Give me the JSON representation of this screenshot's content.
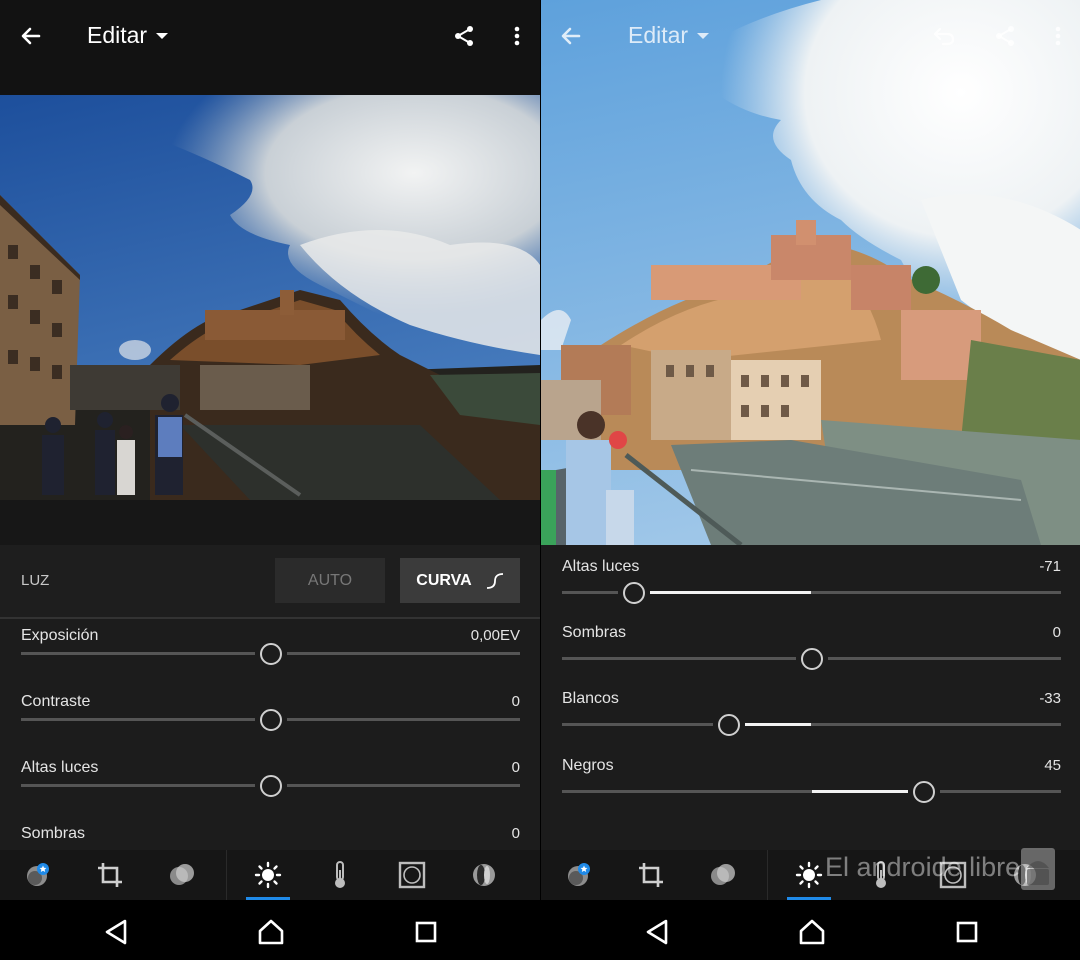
{
  "left": {
    "appbar": {
      "title": "Editar",
      "back_icon": "arrow-left-icon",
      "share_icon": "share-icon",
      "more_icon": "more-vert-icon"
    },
    "light_panel": {
      "section_label": "LUZ",
      "auto_label": "AUTO",
      "curve_label": "CURVA",
      "sliders": [
        {
          "label": "Exposición",
          "value": "0,00EV",
          "position": 0.5
        },
        {
          "label": "Contraste",
          "value": "0",
          "position": 0.5
        },
        {
          "label": "Altas luces",
          "value": "0",
          "position": 0.5
        },
        {
          "label": "Sombras",
          "value": "0",
          "position": 0.5
        }
      ]
    }
  },
  "right": {
    "appbar": {
      "title": "Editar",
      "back_icon": "arrow-left-icon",
      "undo_icon": "undo-icon",
      "share_icon": "share-icon",
      "more_icon": "more-vert-icon"
    },
    "sliders": [
      {
        "label": "Altas luces",
        "value": "-71",
        "position": 0.145
      },
      {
        "label": "Sombras",
        "value": "0",
        "position": 0.5
      },
      {
        "label": "Blancos",
        "value": "-33",
        "position": 0.335
      },
      {
        "label": "Negros",
        "value": "45",
        "position": 0.725
      }
    ]
  },
  "toolbar_tools": [
    "presets-icon",
    "crop-icon",
    "profile-icon",
    "light-icon",
    "color-temperature-icon",
    "effects-vignette-icon",
    "optics-icon"
  ],
  "active_tool": "light-icon",
  "navbar": [
    "nav-back-icon",
    "nav-home-icon",
    "nav-recents-icon"
  ],
  "watermark": {
    "text": "El androide libre"
  },
  "colors": {
    "accent": "#1f8ae8",
    "background": "#1c1c1c",
    "track": "#555555",
    "fill": "#f2f2f2"
  }
}
